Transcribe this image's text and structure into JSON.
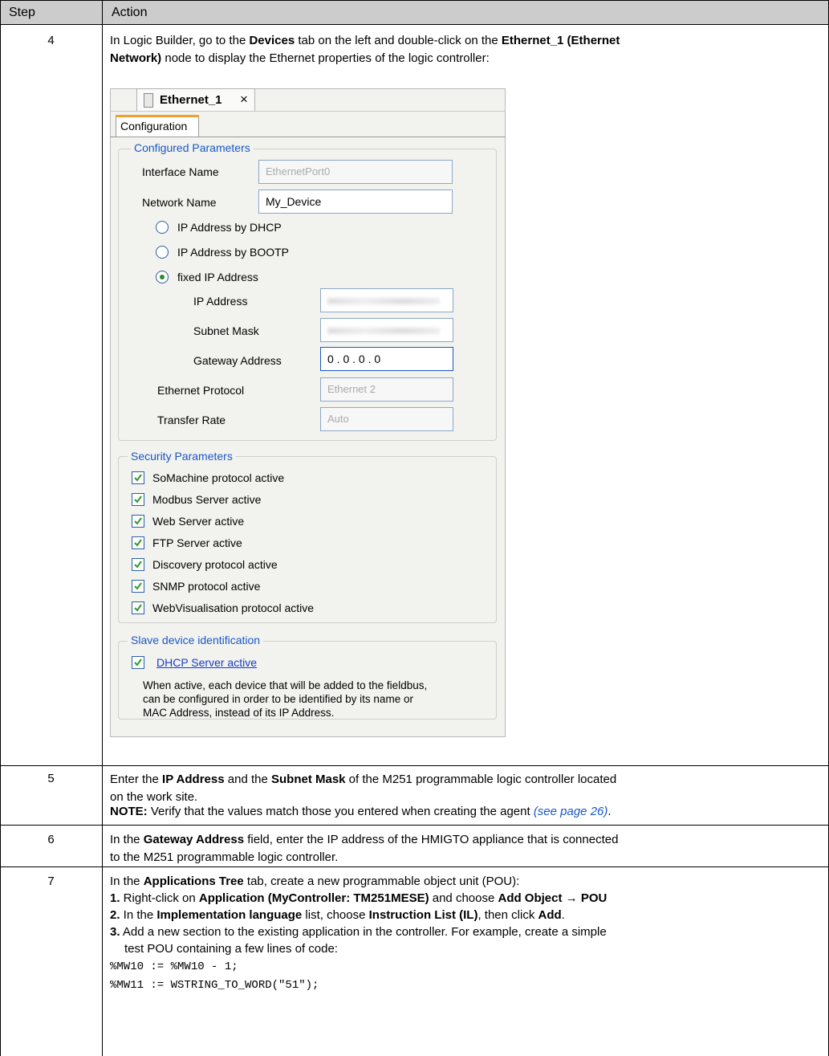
{
  "table": {
    "headers": [
      "Step",
      "Action"
    ],
    "rows": {
      "r4": {
        "step": "4",
        "text": {
          "p1": "In Logic Builder, go to the ",
          "b1": "Devices",
          "p2": " tab on the left and double-click on the ",
          "b2": "Ethernet_1 (Ethernet",
          "b3": "Network)",
          "p3": " node to display the Ethernet properties of the logic controller:"
        }
      },
      "r5": {
        "step": "5",
        "p1": "Enter the ",
        "b1": "IP Address",
        "p2": " and the ",
        "b2": "Subnet Mask",
        "p3": " of the M251 programmable logic controller located",
        "p4": "on the work site.",
        "note_label": "NOTE:",
        "note_text": " Verify that the values match those you entered when creating the agent ",
        "note_link": "(see page 26)",
        "note_end": "."
      },
      "r6": {
        "step": "6",
        "p1": "In the ",
        "b1": "Gateway Address",
        "p2": " field, enter the IP address of the HMIGTO appliance that is connected",
        "p3": "to the M251 programmable logic controller."
      },
      "r7": {
        "step": "7",
        "l1_p1": "In the ",
        "l1_b1": "Applications Tree",
        "l1_p2": " tab, create a new programmable object unit (POU):",
        "l2_n": "1.",
        "l2_p1": " Right-click on ",
        "l2_b1": "Application (MyController: TM251MESE)",
        "l2_p2": " and choose ",
        "l2_b2": "Add Object → POU",
        "l3_n": "2.",
        "l3_p1": " In the ",
        "l3_b1": "Implementation language",
        "l3_p2": " list, choose ",
        "l3_b2": "Instruction List (IL)",
        "l3_p3": ", then click ",
        "l3_b3": "Add",
        "l3_p4": ".",
        "l4_n": "3.",
        "l4_p1": " Add a new section to the existing application in the controller. For example, create a simple",
        "l4_p2": "test POU containing a few lines of code:",
        "code1": "%MW10 := %MW10 - 1;",
        "code2": "%MW11 := WSTRING_TO_WORD(\"51\");"
      }
    }
  },
  "screenshot": {
    "doc_tab": "Ethernet_1",
    "close_glyph": "×",
    "config_tab": "Configuration",
    "configured": {
      "title": "Configured Parameters",
      "interface_name_label": "Interface Name",
      "interface_name_value": "EthernetPort0",
      "network_name_label": "Network Name",
      "network_name_value": "My_Device",
      "radio_dhcp": "IP Address by DHCP",
      "radio_bootp": "IP Address by BOOTP",
      "radio_fixed": "fixed IP Address",
      "ip_label": "IP Address",
      "subnet_label": "Subnet Mask",
      "gateway_label": "Gateway Address",
      "gateway_value": "0  .  0  .  0  .  0",
      "protocol_label": "Ethernet Protocol",
      "protocol_value": "Ethernet 2",
      "rate_label": "Transfer Rate",
      "rate_value": "Auto"
    },
    "security": {
      "title": "Security Parameters",
      "items": [
        "SoMachine protocol active",
        "Modbus Server active",
        "Web Server active",
        "FTP Server active",
        "Discovery protocol active",
        "SNMP protocol active",
        "WebVisualisation protocol active"
      ]
    },
    "slave": {
      "title": "Slave device identification",
      "dhcp_label": "DHCP Server active",
      "desc1": "When active, each device that will be added to the fieldbus,",
      "desc2": "can be configured in order to be identified by its name or",
      "desc3": "MAC Address, instead of its IP Address."
    }
  }
}
